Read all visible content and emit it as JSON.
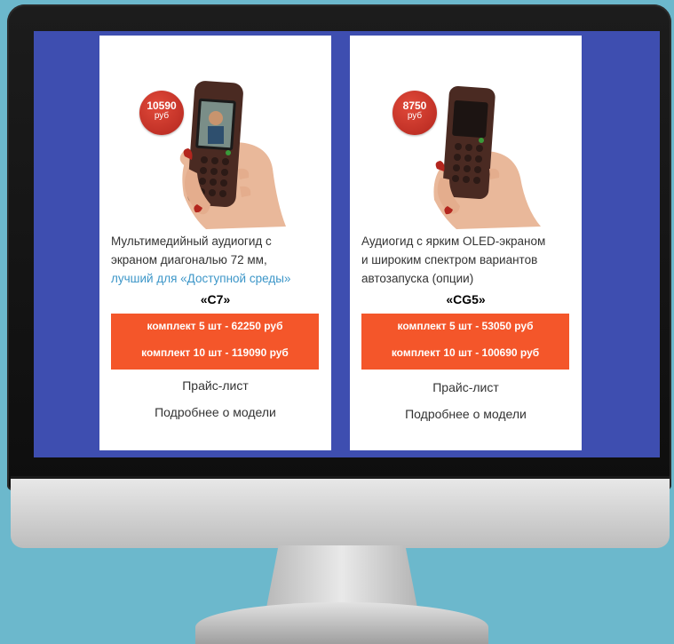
{
  "products": [
    {
      "price": "10590",
      "price_unit": "руб",
      "description_1": "Мультимедийный аудиогид с",
      "description_2": "экраном диагональю 72 мм,",
      "description_link": "лучший для «Доступной среды»",
      "model": "«C7»",
      "kit_5": "комплект 5 шт - 62250 руб",
      "kit_10": "комплект 10 шт - 119090 руб",
      "price_list": "Прайс-лист",
      "details": "Подробнее о модели"
    },
    {
      "price": "8750",
      "price_unit": "руб",
      "description_1": "Аудиогид с ярким OLED-экраном",
      "description_2": "и широким спектром вариантов",
      "description_3": "автозапуска (опции)",
      "model": "«CG5»",
      "kit_5": "комплект 5 шт - 53050 руб",
      "kit_10": "комплект 10 шт - 100690 руб",
      "price_list": "Прайс-лист",
      "details": "Подробнее о модели"
    }
  ],
  "colors": {
    "background": "#6cb8cc",
    "screen": "#3e4eb0",
    "accent_orange": "#f4562a",
    "badge_red": "#c0302a",
    "link_blue": "#3c96c8"
  }
}
